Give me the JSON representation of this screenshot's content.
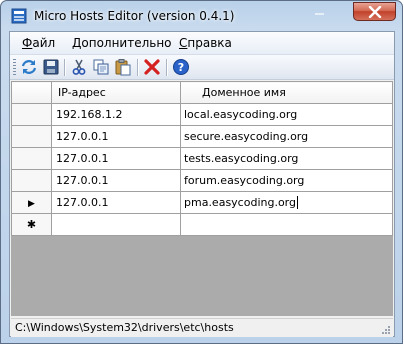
{
  "window": {
    "title": "Micro Hosts Editor (version 0.4.1)"
  },
  "menu": {
    "file": {
      "accel": "Ф",
      "rest": "айл"
    },
    "extra": {
      "accel": "Д",
      "rest": "ополнительно"
    },
    "help": {
      "accel": "С",
      "rest": "правка"
    }
  },
  "toolbar": {
    "icons": [
      "refresh-icon",
      "save-icon",
      "cut-icon",
      "copy-icon",
      "paste-icon",
      "delete-icon",
      "help-icon"
    ]
  },
  "grid": {
    "columns": [
      "IP-адрес",
      "Доменное имя"
    ],
    "rows": [
      {
        "ip": "192.168.1.2",
        "domain": "local.easycoding.org"
      },
      {
        "ip": "127.0.0.1",
        "domain": "secure.easycoding.org"
      },
      {
        "ip": "127.0.0.1",
        "domain": "tests.easycoding.org"
      },
      {
        "ip": "127.0.0.1",
        "domain": "forum.easycoding.org"
      },
      {
        "ip": "127.0.0.1",
        "domain": "pma.easycoding.org"
      }
    ],
    "current_row_marker": "▶",
    "new_row_marker": "✱"
  },
  "status": {
    "path": "C:\\Windows\\System32\\drivers\\etc\\hosts"
  },
  "colors": {
    "close_button": "#c2412a",
    "delete_icon": "#d42020",
    "help_icon": "#2a62c9"
  }
}
